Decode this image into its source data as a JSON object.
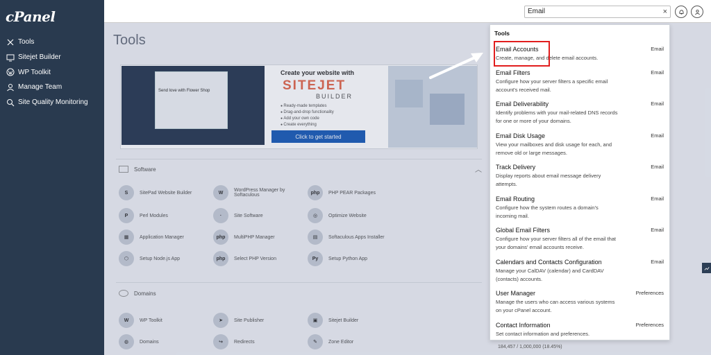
{
  "sidebar": {
    "logo": "cPanel",
    "items": [
      {
        "label": "Tools",
        "icon": "tools-icon"
      },
      {
        "label": "Sitejet Builder",
        "icon": "monitor-icon"
      },
      {
        "label": "WP Toolkit",
        "icon": "wordpress-icon"
      },
      {
        "label": "Manage Team",
        "icon": "user-icon"
      },
      {
        "label": "Site Quality Monitoring",
        "icon": "magnifier-icon"
      }
    ]
  },
  "header": {
    "search_value": "Email",
    "clear": "×",
    "notifications_icon": "bell-icon",
    "user_icon": "user-circle-icon"
  },
  "main": {
    "title": "Tools",
    "banner": {
      "heading": "Create your website with",
      "brand": "SITEJET",
      "sub": "BUILDER",
      "bullets": [
        "Ready-made templates",
        "Drag-and-drop functionality",
        "Add your own code",
        "Create everything"
      ],
      "cta": "Click to get started",
      "mock_text": "Send love with Flower Shop"
    },
    "sections": [
      {
        "title": "Software",
        "items": [
          [
            "SitePad Website Builder",
            "WordPress Manager by Softaculous",
            "PHP PEAR Packages"
          ],
          [
            "Perl Modules",
            "Site Software",
            "Optimize Website"
          ],
          [
            "Application Manager",
            "MultiPHP Manager",
            "Softaculous Apps Installer"
          ],
          [
            "Setup Node.js App",
            "Select PHP Version",
            "Setup Python App"
          ]
        ]
      },
      {
        "title": "Domains",
        "items": [
          [
            "WP Toolkit",
            "Site Publisher",
            "Sitejet Builder"
          ],
          [
            "Domains",
            "Redirects",
            "Zone Editor"
          ]
        ]
      }
    ],
    "bandwidth": "184,457 / 1,000,000   (18.45%)"
  },
  "dropdown": {
    "section_title": "Tools",
    "items": [
      {
        "name": "Email Accounts",
        "category": "Email",
        "desc": "Create, manage, and delete email accounts."
      },
      {
        "name": "Email Filters",
        "category": "Email",
        "desc": "Configure how your server filters a specific email account's received mail."
      },
      {
        "name": "Email Deliverability",
        "category": "Email",
        "desc": "Identify problems with your mail-related DNS records for one or more of your domains."
      },
      {
        "name": "Email Disk Usage",
        "category": "Email",
        "desc": "View your mailboxes and disk usage for each, and remove old or large messages."
      },
      {
        "name": "Track Delivery",
        "category": "Email",
        "desc": "Display reports about email message delivery attempts."
      },
      {
        "name": "Email Routing",
        "category": "Email",
        "desc": "Configure how the system routes a domain's incoming mail."
      },
      {
        "name": "Global Email Filters",
        "category": "Email",
        "desc": "Configure how your server filters all of the email that your domains' email accounts receive."
      },
      {
        "name": "Calendars and Contacts Configuration",
        "category": "Email",
        "desc": "Manage your CalDAV (calendar) and CardDAV (contacts) accounts."
      },
      {
        "name": "User Manager",
        "category": "Preferences",
        "desc": "Manage the users who can access various systems on your cPanel account."
      },
      {
        "name": "Contact Information",
        "category": "Preferences",
        "desc": "Set contact information and preferences."
      }
    ]
  },
  "colors": {
    "sidebar_bg": "#293a4f",
    "highlight": "#e11d1d",
    "accent": "#1f5fb8",
    "sitejet": "#e36a4f"
  }
}
